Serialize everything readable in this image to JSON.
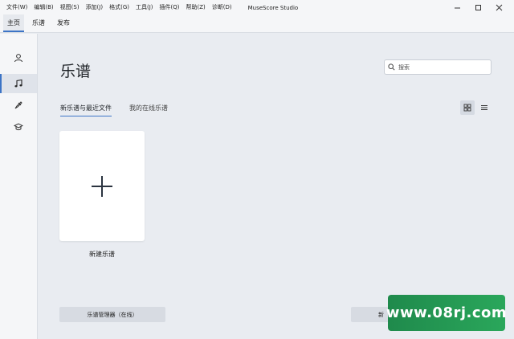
{
  "menubar": {
    "items": [
      "文件(W)",
      "编辑(B)",
      "视图(S)",
      "添加(J)",
      "格式(G)",
      "工具(J)",
      "插件(Q)",
      "帮助(Z)",
      "诊断(D)"
    ],
    "app_title": "MuseScore Studio"
  },
  "tabs": [
    {
      "label": "主页",
      "active": true
    },
    {
      "label": "乐谱",
      "active": false
    },
    {
      "label": "发布",
      "active": false
    }
  ],
  "sidebar": {
    "items": [
      {
        "icon": "account-icon",
        "active": false
      },
      {
        "icon": "music-note-icon",
        "active": true
      },
      {
        "icon": "plugins-icon",
        "active": false
      },
      {
        "icon": "learn-icon",
        "active": false
      }
    ]
  },
  "main": {
    "title": "乐谱",
    "search": {
      "placeholder": "搜索",
      "value": ""
    },
    "subtabs": [
      {
        "label": "新乐谱与最近文件",
        "active": true
      },
      {
        "label": "我的在线乐谱",
        "active": false
      }
    ],
    "view_mode": "grid",
    "new_score_label": "新建乐谱",
    "bottom_left_button": "乐谱管理器（在线）",
    "bottom_right_button": "新"
  },
  "watermark": "www.08rj.com",
  "colors": {
    "accent": "#3c74c6",
    "background": "#e9ecf1",
    "watermark_green": "#2aa75b"
  }
}
